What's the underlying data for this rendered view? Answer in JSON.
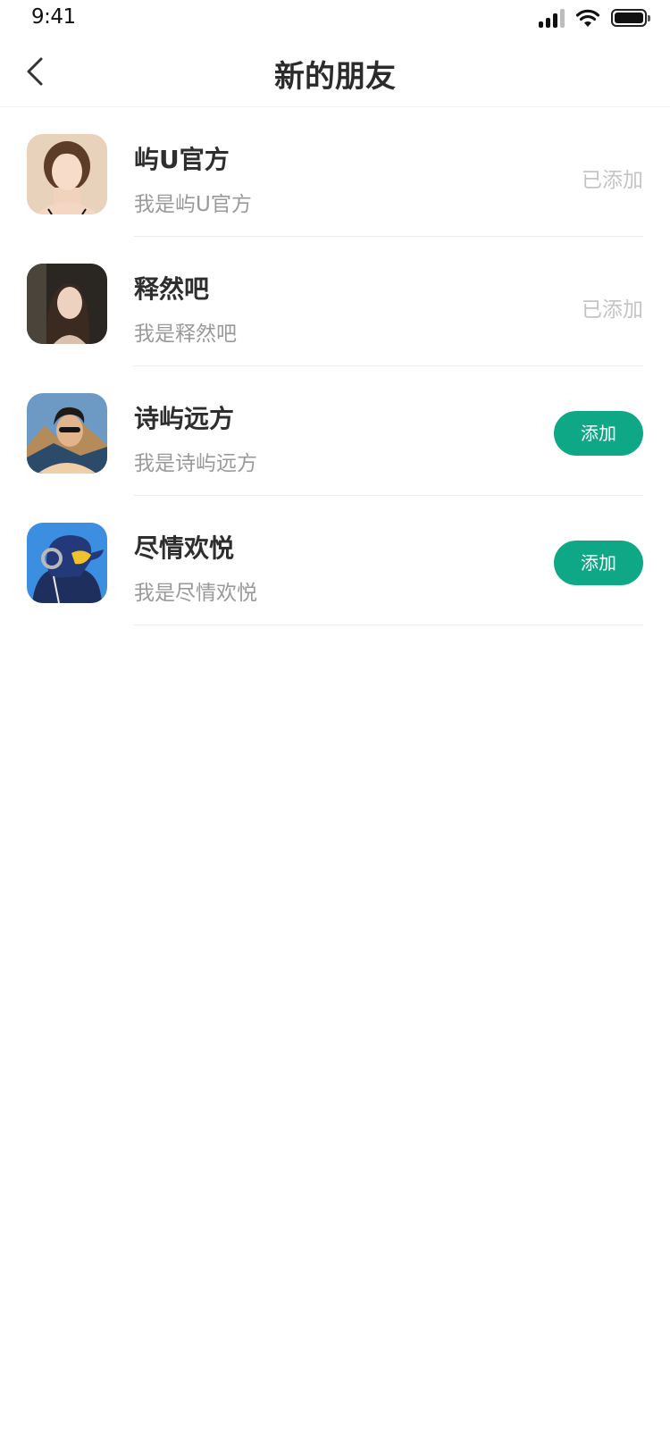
{
  "status_bar": {
    "time": "9:41"
  },
  "nav": {
    "title": "新的朋友"
  },
  "friends": [
    {
      "name": "屿U官方",
      "message": "我是屿U官方",
      "status": "已添加",
      "added": true
    },
    {
      "name": "释然吧",
      "message": "我是释然吧",
      "status": "已添加",
      "added": true
    },
    {
      "name": "诗屿远方",
      "message": "我是诗屿远方",
      "status": "添加",
      "added": false
    },
    {
      "name": "尽情欢悦",
      "message": "我是尽情欢悦",
      "status": "添加",
      "added": false
    }
  ],
  "colors": {
    "accent": "#0fa887",
    "title_text": "#2b2b2b",
    "secondary_text": "#9a9a9a",
    "added_text": "#c4c4c4",
    "divider": "#ececec"
  }
}
